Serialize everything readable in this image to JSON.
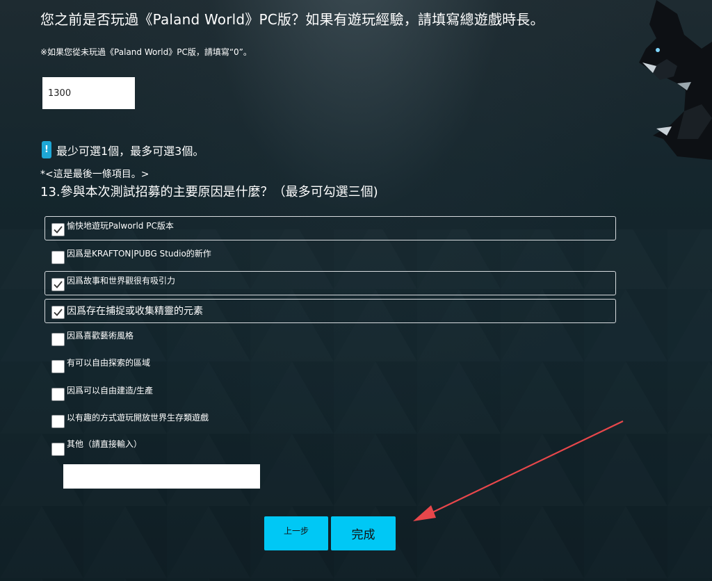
{
  "q12": {
    "title": "您之前是否玩過《Paland World》PC版？如果有遊玩經驗，請填寫總遊戲時長。",
    "note": "※如果您從未玩過《Paland World》PC版，請填寫“0”。",
    "value": "1300"
  },
  "notice": {
    "icon": "exclamation-icon",
    "text": "最少可選1個，最多可選3個。"
  },
  "last_item": "*<這是最後一條項目。>",
  "q13": {
    "title": "13.參與本次測試招募的主要原因是什麼？（最多可勾選三個)",
    "options": [
      {
        "label": "愉快地遊玩Palworld PC版本",
        "checked": true
      },
      {
        "label": "因爲是KRAFTON|PUBG Studio的新作",
        "checked": false
      },
      {
        "label": "因爲故事和世界觀很有吸引力",
        "checked": true
      },
      {
        "label": "因爲存在捕捉或收集精靈的元素",
        "checked": true
      },
      {
        "label": "因爲喜歡藝術風格",
        "checked": false
      },
      {
        "label": "有可以自由探索的區域",
        "checked": false
      },
      {
        "label": "因爲可以自由建造/生產",
        "checked": false
      },
      {
        "label": "以有趣的方式遊玩開放世界生存類遊戲",
        "checked": false
      },
      {
        "label": "其他（請直接輸入）",
        "checked": false
      }
    ],
    "other_value": ""
  },
  "buttons": {
    "prev": "上一步",
    "finish": "完成"
  },
  "colors": {
    "accent": "#00c8f5",
    "background": "#13242b",
    "annotation_arrow": "#e8474b"
  }
}
